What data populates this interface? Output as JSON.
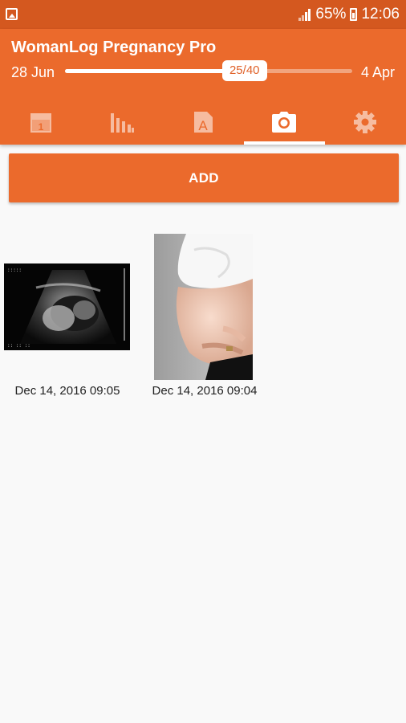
{
  "status_bar": {
    "battery": "65%",
    "time": "12:06",
    "icons": [
      "gallery-icon",
      "signal-icon",
      "battery-icon"
    ]
  },
  "app": {
    "title": "WomanLog Pregnancy Pro",
    "start_date": "28 Jun",
    "end_date": "4 Apr",
    "progress_label": "25/40",
    "progress_fraction": 0.625
  },
  "tabs": [
    {
      "icon": "calendar-icon",
      "active": false
    },
    {
      "icon": "bar-chart-icon",
      "active": false
    },
    {
      "icon": "document-icon",
      "active": false
    },
    {
      "icon": "camera-icon",
      "active": true
    },
    {
      "icon": "gear-icon",
      "active": false
    }
  ],
  "actions": {
    "add_label": "ADD"
  },
  "photos": [
    {
      "caption": "Dec 14, 2016 09:05",
      "kind": "ultrasound"
    },
    {
      "caption": "Dec 14, 2016 09:04",
      "kind": "belly"
    }
  ],
  "colors": {
    "accent": "#eb6a2c",
    "status_bar": "#d4581f",
    "background": "#f9f9f9"
  }
}
